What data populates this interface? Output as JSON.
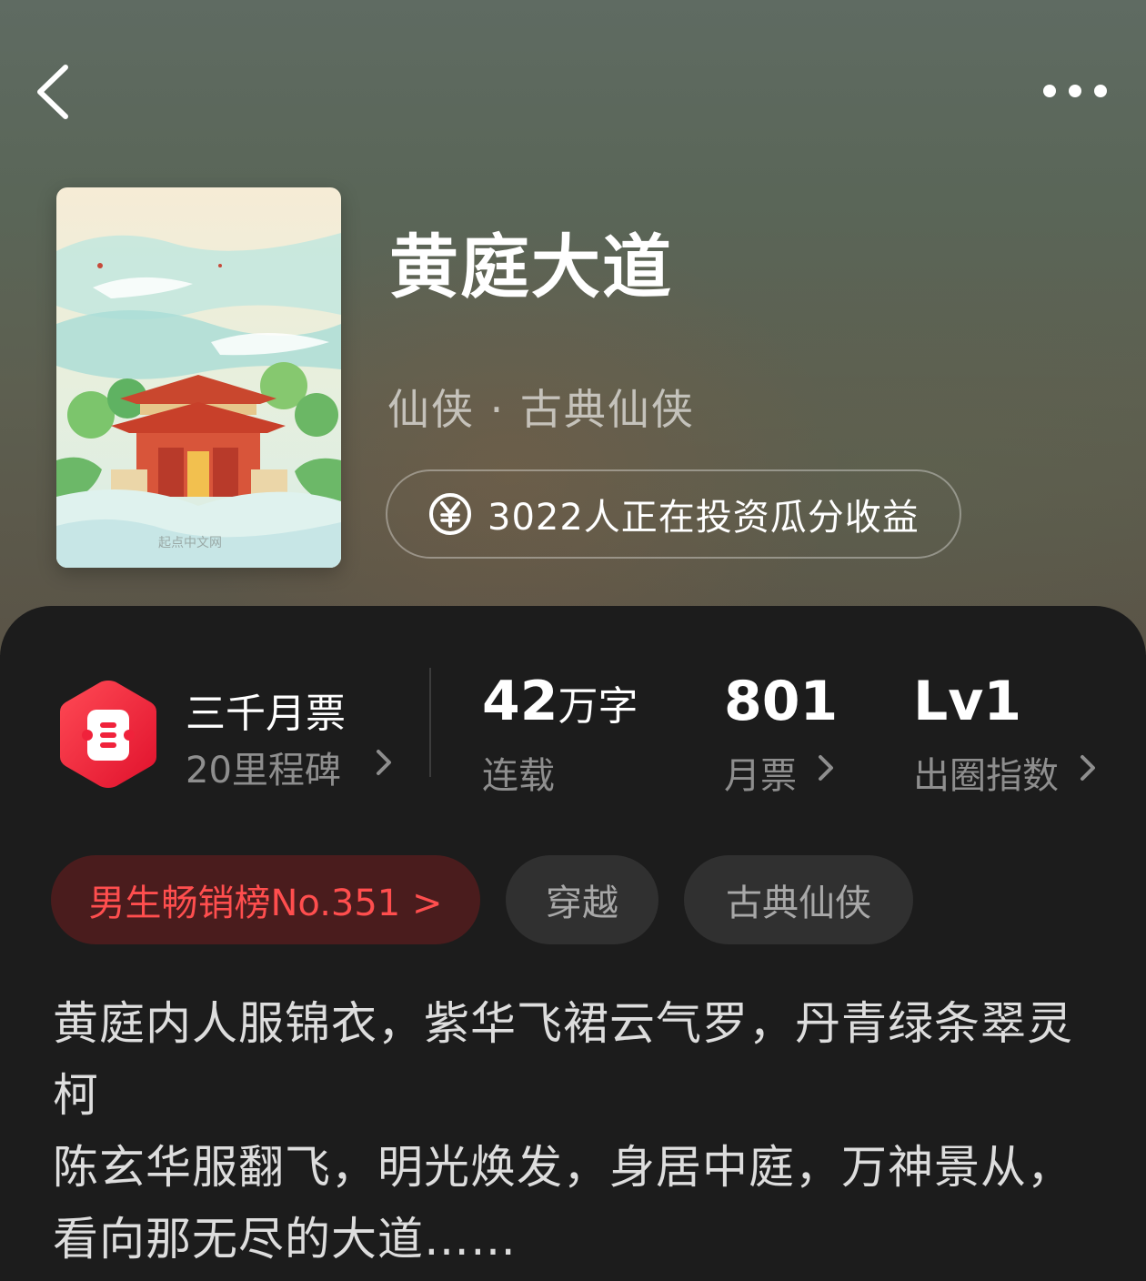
{
  "header": {
    "back_icon": "chevron-left-icon",
    "more_icon": "more-dots-icon"
  },
  "book": {
    "title": "黄庭大道",
    "category": "仙侠 · 古典仙侠",
    "cover_watermark": "起点中文网",
    "invest_text": "3022人正在投资瓜分收益",
    "invest_icon": "yen-coin-icon"
  },
  "stats": {
    "monthly_badge": {
      "title": "三千月票",
      "subtitle": "20里程碑",
      "icon": "ticket-hexagon-icon",
      "color": "#f0223b"
    },
    "word_count": {
      "value": "42",
      "unit": "万字",
      "label": "连载"
    },
    "monthly_votes": {
      "value": "801",
      "label": "月票"
    },
    "influence": {
      "value": "Lv1",
      "label": "出圈指数"
    }
  },
  "tags": {
    "rank": "男生畅销榜No.351 >",
    "tag1": "穿越",
    "tag2": "古典仙侠"
  },
  "description": {
    "line1": "黄庭内人服锦衣，紫华飞裙云气罗，丹青绿条翠灵柯",
    "line2": "陈玄华服翻飞，明光焕发，身居中庭，万神景从，看向那无尽的大道……"
  },
  "colors": {
    "accent_red": "#ff4e4e",
    "panel_bg": "#1c1c1c"
  }
}
